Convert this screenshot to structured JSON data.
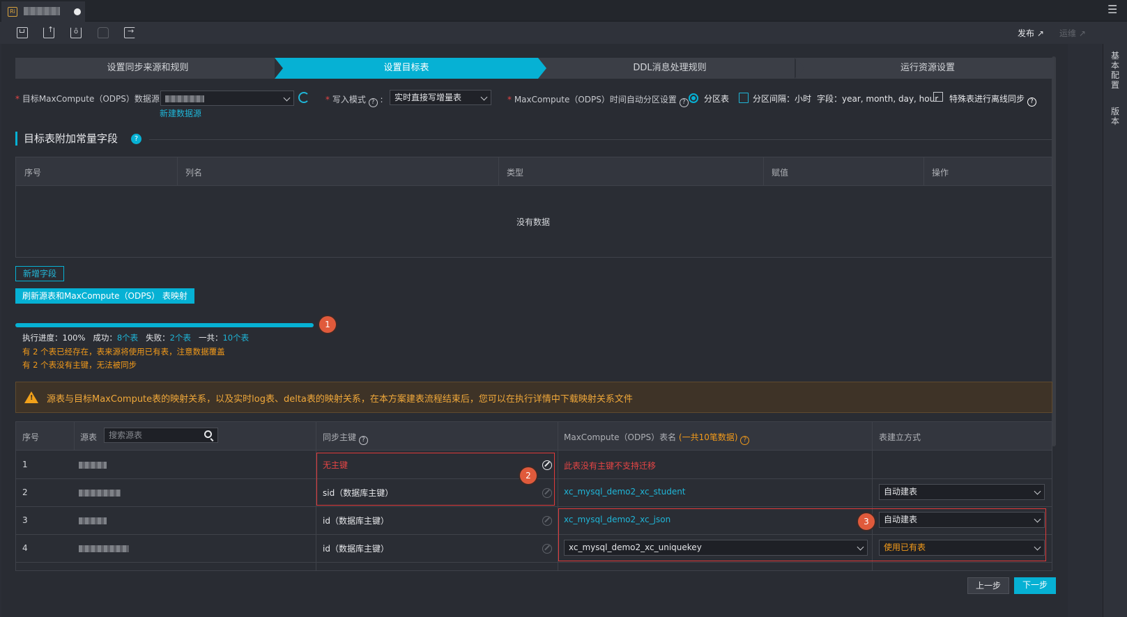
{
  "tab": {
    "logo": "Ri"
  },
  "toolbar": {
    "publish": "发布",
    "ops": "运维"
  },
  "rail": {
    "basic_config": "基本配置",
    "version": "版本"
  },
  "steps": [
    "设置同步来源和规则",
    "设置目标表",
    "DDL消息处理规则",
    "运行资源设置"
  ],
  "form": {
    "datasource_label": "目标MaxCompute（ODPS）数据源:",
    "new_datasource": "新建数据源",
    "write_mode_label": "写入模式",
    "write_mode_value": "实时直接写增量表",
    "partition_label": "MaxCompute（ODPS）时间自动分区设置",
    "partition_option": "分区表",
    "partition_interval": "分区间隔：小时",
    "partition_fields": "字段：year, month, day, hour",
    "special_sync": "特殊表进行离线同步"
  },
  "const_section": {
    "title": "目标表附加常量字段",
    "columns": [
      "序号",
      "列名",
      "类型",
      "赋值",
      "操作"
    ],
    "empty": "没有数据",
    "add_field": "新增字段",
    "refresh_mapping": "刷新源表和MaxCompute（ODPS） 表映射"
  },
  "progress": {
    "percent": 100,
    "label_progress": "执行进度：",
    "value_progress": "100%",
    "label_success": "成功：",
    "value_success": "8个表",
    "label_fail": "失败：",
    "value_fail": "2个表",
    "label_total": "一共：",
    "value_total": "10个表",
    "warn1": "有 2 个表已经存在，表来源将使用已有表，注意数据覆盖",
    "warn2": "有 2 个表没有主键，无法被同步"
  },
  "alert": "源表与目标MaxCompute表的映射关系，以及实时log表、delta表的映射关系，在本方案建表流程结束后，您可以在执行详情中下载映射关系文件",
  "mapping": {
    "columns": {
      "index": "序号",
      "source": "源表",
      "search_placeholder": "搜索源表",
      "pk": "同步主键",
      "target": "MaxCompute（ODPS）表名",
      "target_count": "(一共10笔数据)",
      "mode": "表建立方式"
    },
    "rows": [
      {
        "index": "1",
        "pk": "无主键",
        "target": "此表没有主键不支持迁移",
        "mode": ""
      },
      {
        "index": "2",
        "pk": "sid（数据库主键）",
        "target": "xc_mysql_demo2_xc_student",
        "mode": "自动建表"
      },
      {
        "index": "3",
        "pk": "id（数据库主键）",
        "target": "xc_mysql_demo2_xc_json",
        "mode": "自动建表"
      },
      {
        "index": "4",
        "pk": "id（数据库主键）",
        "target": "xc_mysql_demo2_xc_uniquekey",
        "mode": "使用已有表"
      }
    ]
  },
  "callouts": [
    "1",
    "2",
    "3"
  ],
  "footer": {
    "prev": "上一步",
    "next": "下一步"
  },
  "colors": {
    "accent": "#06b1d4",
    "error": "#e54545",
    "warning": "#f29a1a"
  }
}
